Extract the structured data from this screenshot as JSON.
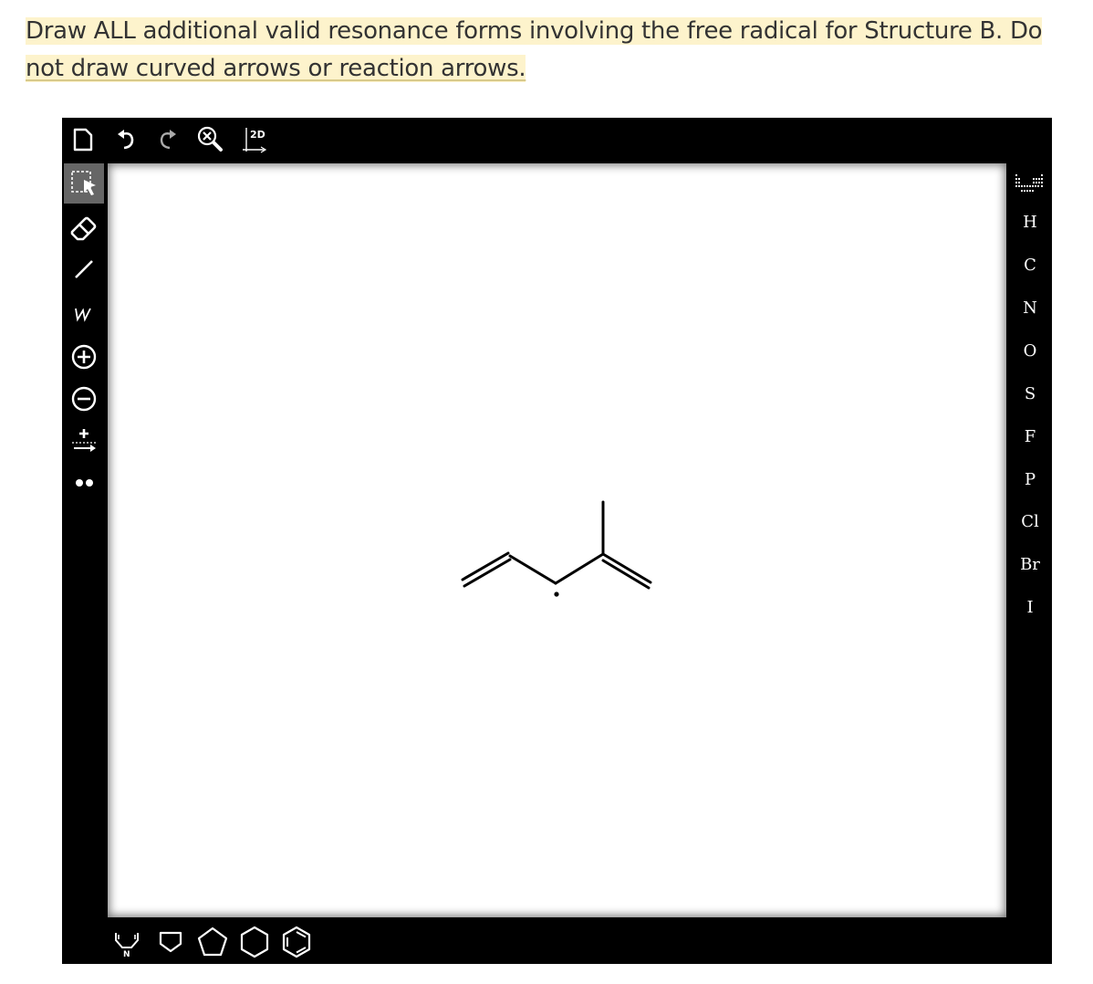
{
  "question": {
    "line1": "Draw ALL additional valid resonance forms involving the free radical for Structure B. Do",
    "line2": "not draw curved arrows or reaction arrows."
  },
  "toolbar": {
    "top_icons": [
      "new-document-icon",
      "undo-icon",
      "redo-icon",
      "zoom-clear-icon",
      "clean-2d-icon"
    ],
    "clean_label": "2D"
  },
  "left_tools": [
    "select",
    "erase",
    "single-bond",
    "chain",
    "positive-charge",
    "negative-charge",
    "charge-arrow",
    "lone-pair"
  ],
  "elements": [
    "H",
    "C",
    "N",
    "O",
    "S",
    "F",
    "P",
    "Cl",
    "Br",
    "I"
  ],
  "bottom_templates": [
    "pyrrole",
    "cyclobutane",
    "cyclopentane",
    "cyclohexane",
    "benzene"
  ],
  "bottom_labels": {
    "pyrrole_atom": "N"
  },
  "colors": {
    "editor_bg": "#000000",
    "highlight": "#fdf3cc",
    "text": "#333333"
  }
}
